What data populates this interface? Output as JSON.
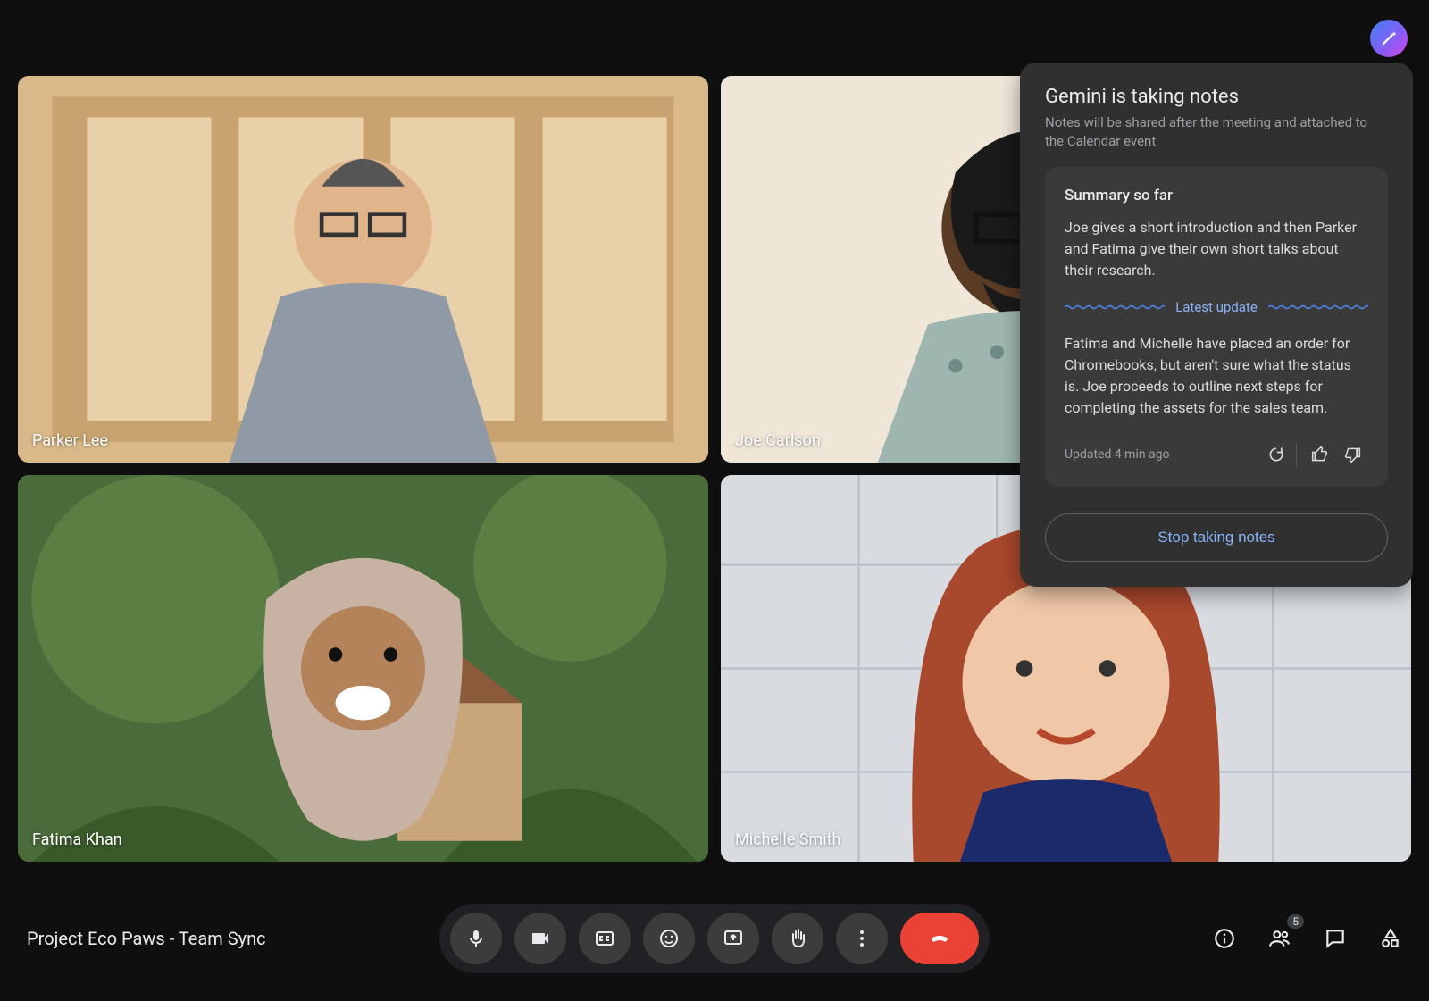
{
  "meeting": {
    "title": "Project Eco Paws - Team Sync",
    "participant_count": "5"
  },
  "participants": [
    {
      "name": "Parker Lee",
      "active": false
    },
    {
      "name": "Joe Carlson",
      "active": true
    },
    {
      "name": "Fatima Khan",
      "active": false
    },
    {
      "name": "Michelle Smith",
      "active": false
    }
  ],
  "notes_panel": {
    "title": "Gemini is taking notes",
    "subtitle": "Notes will be shared after the meeting and attached to the Calendar event",
    "summary_heading": "Summary so far",
    "summary_text": "Joe gives a short introduction and then Parker and Fatima give their own short talks about their research.",
    "latest_label": "Latest update",
    "latest_text": "Fatima and Michelle have placed an order for Chromebooks, but aren't sure what the status is. Joe proceeds to outline next steps for completing the assets for the sales team.",
    "updated_text": "Updated 4 min ago",
    "stop_label": "Stop taking notes"
  },
  "toolbar": {
    "mic": "microphone",
    "camera": "camera",
    "captions": "closed-captions",
    "emoji": "emoji",
    "present": "present-screen",
    "raise_hand": "raise-hand",
    "more": "more-options",
    "hangup": "leave-call"
  },
  "right_controls": {
    "info": "meeting-info",
    "people": "people",
    "chat": "chat",
    "activities": "activities"
  }
}
